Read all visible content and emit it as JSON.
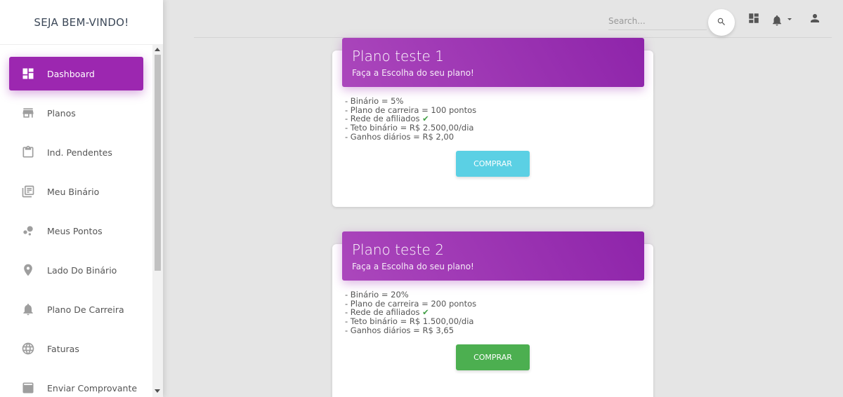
{
  "sidebar": {
    "brand": "SEJA BEM-VINDO!",
    "items": [
      {
        "label": "Dashboard",
        "icon": "dashboard-icon",
        "active": true
      },
      {
        "label": "Planos",
        "icon": "store-icon"
      },
      {
        "label": "Ind. Pendentes",
        "icon": "clipboard-icon"
      },
      {
        "label": "Meu Binário",
        "icon": "library-books-icon"
      },
      {
        "label": "Meus Pontos",
        "icon": "bubble-chart-icon"
      },
      {
        "label": "Lado Do Binário",
        "icon": "location-pin-icon"
      },
      {
        "label": "Plano De Carreira",
        "icon": "bell-icon"
      },
      {
        "label": "Faturas",
        "icon": "globe-icon"
      },
      {
        "label": "Enviar Comprovante",
        "icon": "upload-box-icon"
      }
    ]
  },
  "topbar": {
    "search_placeholder": "Search...",
    "icons": [
      "search-icon",
      "dashboard-icon",
      "notifications-icon",
      "person-icon"
    ]
  },
  "plans": [
    {
      "title": "Plano teste 1",
      "subtitle": "Faça a Escolha do seu plano!",
      "lines": [
        "- Binário = 5%",
        "- Plano de carreira = 100 pontos",
        "- Rede de afiliados",
        "- Teto binário = R$ 2.500,00/dia",
        "- Ganhos diários = R$ 2,00"
      ],
      "button": "COMPRAR",
      "button_color": "#5bd0e4"
    },
    {
      "title": "Plano teste 2",
      "subtitle": "Faça a Escolha do seu plano!",
      "lines": [
        "- Binário = 20%",
        "- Plano de carreira = 200 pontos",
        "- Rede de afiliados",
        "- Teto binário = R$ 1.500,00/dia",
        "- Ganhos diários = R$ 3,65"
      ],
      "button": "COMPRAR",
      "button_color": "#4caf50"
    }
  ],
  "colors": {
    "accent": "#9c27b0",
    "check": "#43a047"
  }
}
